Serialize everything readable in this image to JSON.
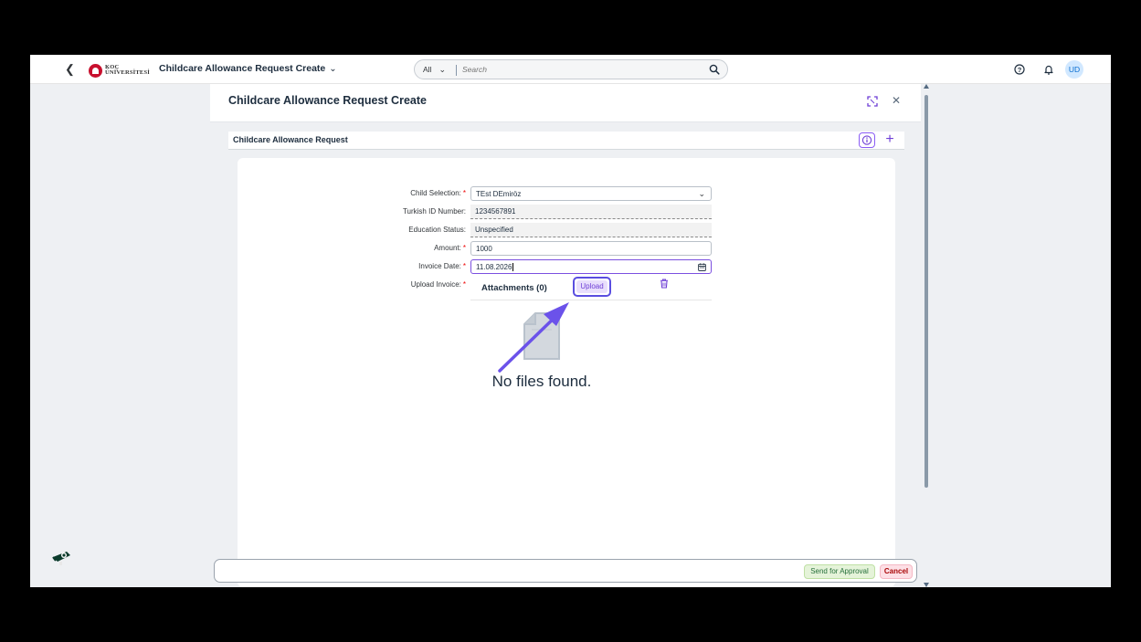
{
  "shell": {
    "app_title": "Childcare Allowance Request Create",
    "logo_text_line1": "KOÇ",
    "logo_text_line2": "ÜNİVERSİTESİ",
    "search_scope": "All",
    "search_placeholder": "Search",
    "avatar_initials": "UD"
  },
  "dialog": {
    "title": "Childcare Allowance Request Create",
    "section_title": "Childcare Allowance Request"
  },
  "form": {
    "child_selection": {
      "label": "Child Selection:",
      "value": "TEst DEmiröz",
      "required": true
    },
    "turkish_id": {
      "label": "Turkish ID Number:",
      "value": "1234567891"
    },
    "education_status": {
      "label": "Education Status:",
      "value": "Unspecified"
    },
    "amount": {
      "label": "Amount:",
      "value": "1000",
      "required": true
    },
    "invoice_date": {
      "label": "Invoice Date:",
      "value": "11.08.2026",
      "required": true
    },
    "upload_invoice": {
      "label": "Upload Invoice:",
      "required": true
    }
  },
  "attachments": {
    "title": "Attachments (0)",
    "upload_label": "Upload",
    "empty_text": "No files found."
  },
  "footer": {
    "send_label": "Send for Approval",
    "cancel_label": "Cancel"
  },
  "colors": {
    "accent": "#6e3fd6",
    "highlight": "#5a4ee0",
    "required": "#ee0000",
    "send_bg": "#e5f3d9",
    "cancel_bg": "#fde0e6"
  },
  "icons": [
    "back-icon",
    "search-icon",
    "help-icon",
    "bell-icon",
    "fullscreen-icon",
    "close-icon",
    "info-icon",
    "add-icon",
    "chevron-down-icon",
    "calendar-icon",
    "trash-icon",
    "no-files-icon"
  ]
}
